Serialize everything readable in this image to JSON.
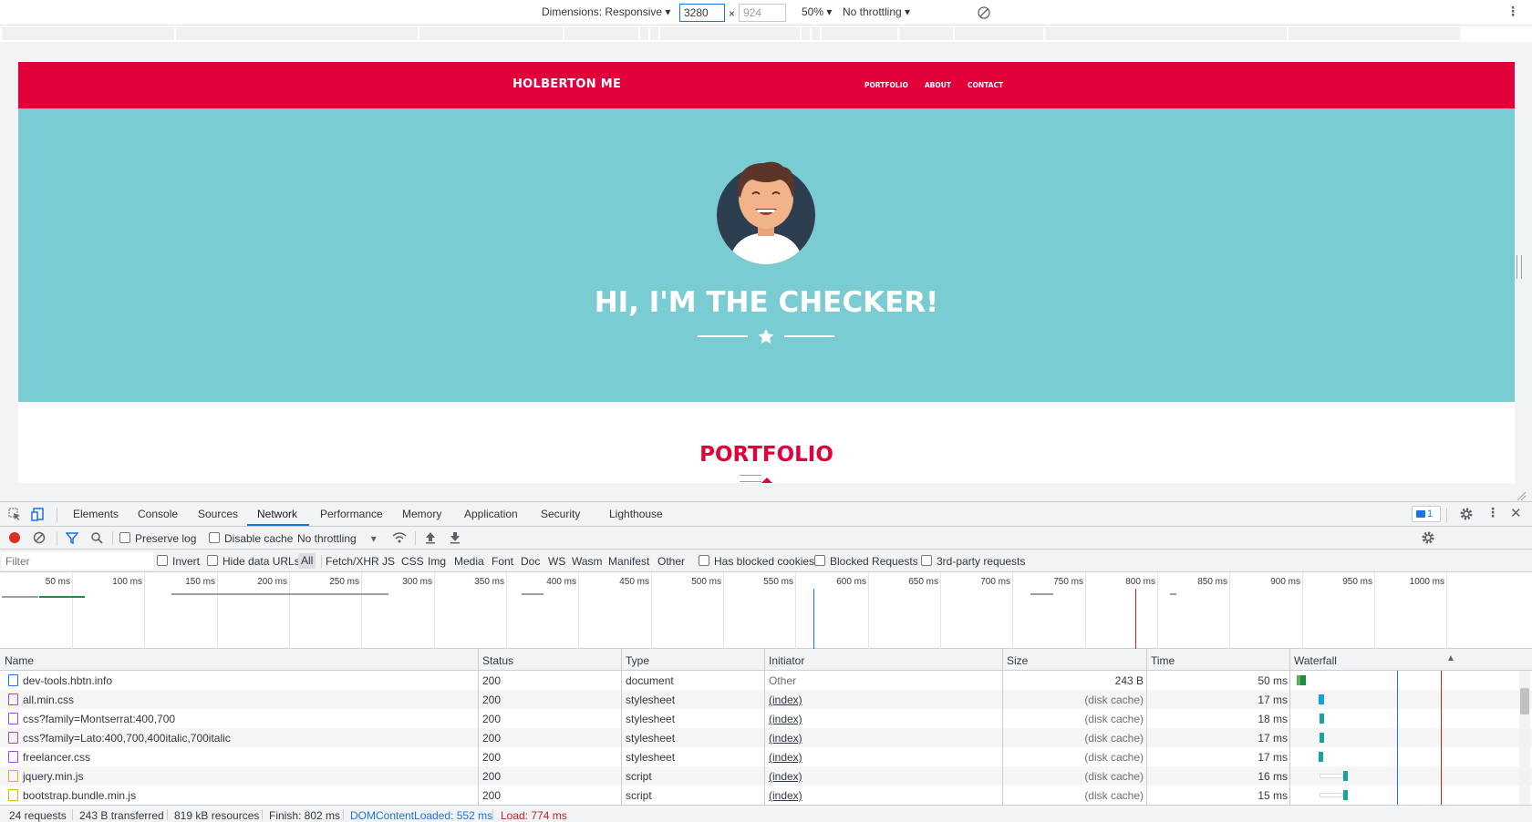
{
  "device_toolbar": {
    "dimensions_label": "Dimensions: Responsive",
    "width": "3280",
    "height_placeholder": "924",
    "times": "×",
    "zoom": "50%",
    "throttling": "No throttling"
  },
  "site": {
    "brand": "HOLBERTON ME",
    "nav": [
      "PORTFOLIO",
      "ABOUT",
      "CONTACT"
    ],
    "hero_title": "HI, I'M THE CHECKER!",
    "section_title": "PORTFOLIO",
    "colors": {
      "nav": "#e2003a",
      "hero": "#79cdd2"
    }
  },
  "devtools": {
    "tabs": [
      "Elements",
      "Console",
      "Sources",
      "Network",
      "Performance",
      "Memory",
      "Application",
      "Security",
      "Lighthouse"
    ],
    "active_tab": "Network",
    "issues_count": "1",
    "toolbar": {
      "preserve_log": "Preserve log",
      "disable_cache": "Disable cache",
      "throttling": "No throttling"
    },
    "filter": {
      "placeholder": "Filter",
      "invert": "Invert",
      "hide_data_urls": "Hide data URLs",
      "types": [
        "All",
        "Fetch/XHR",
        "JS",
        "CSS",
        "Img",
        "Media",
        "Font",
        "Doc",
        "WS",
        "Wasm",
        "Manifest",
        "Other"
      ],
      "has_blocked_cookies": "Has blocked cookies",
      "blocked_requests": "Blocked Requests",
      "third_party": "3rd-party requests"
    },
    "overview_ticks": [
      "50 ms",
      "100 ms",
      "150 ms",
      "200 ms",
      "250 ms",
      "300 ms",
      "350 ms",
      "400 ms",
      "450 ms",
      "500 ms",
      "550 ms",
      "600 ms",
      "650 ms",
      "700 ms",
      "750 ms",
      "800 ms",
      "850 ms",
      "900 ms",
      "950 ms",
      "1000 ms"
    ],
    "columns": {
      "name": "Name",
      "status": "Status",
      "type": "Type",
      "initiator": "Initiator",
      "size": "Size",
      "time": "Time",
      "waterfall": "Waterfall"
    },
    "requests": [
      {
        "name": "dev-tools.hbtn.info",
        "status": "200",
        "type": "document",
        "initiator": "Other",
        "size": "243 B",
        "time": "50 ms",
        "icon": "document-icon"
      },
      {
        "name": "all.min.css",
        "status": "200",
        "type": "stylesheet",
        "initiator": "(index)",
        "size": "(disk cache)",
        "time": "17 ms",
        "icon": "stylesheet-icon"
      },
      {
        "name": "css?family=Montserrat:400,700",
        "status": "200",
        "type": "stylesheet",
        "initiator": "(index)",
        "size": "(disk cache)",
        "time": "18 ms",
        "icon": "stylesheet-icon"
      },
      {
        "name": "css?family=Lato:400,700,400italic,700italic",
        "status": "200",
        "type": "stylesheet",
        "initiator": "(index)",
        "size": "(disk cache)",
        "time": "17 ms",
        "icon": "stylesheet-icon"
      },
      {
        "name": "freelancer.css",
        "status": "200",
        "type": "stylesheet",
        "initiator": "(index)",
        "size": "(disk cache)",
        "time": "17 ms",
        "icon": "stylesheet-icon"
      },
      {
        "name": "jquery.min.js",
        "status": "200",
        "type": "script",
        "initiator": "(index)",
        "size": "(disk cache)",
        "time": "16 ms",
        "icon": "script-icon"
      },
      {
        "name": "bootstrap.bundle.min.js",
        "status": "200",
        "type": "script",
        "initiator": "(index)",
        "size": "(disk cache)",
        "time": "15 ms",
        "icon": "script-icon"
      }
    ],
    "summary": {
      "requests": "24 requests",
      "transferred": "243 B transferred",
      "resources": "819 kB resources",
      "finish": "Finish: 802 ms",
      "dom_content_loaded": "DOMContentLoaded: 552 ms",
      "load": "Load: 774 ms"
    }
  }
}
